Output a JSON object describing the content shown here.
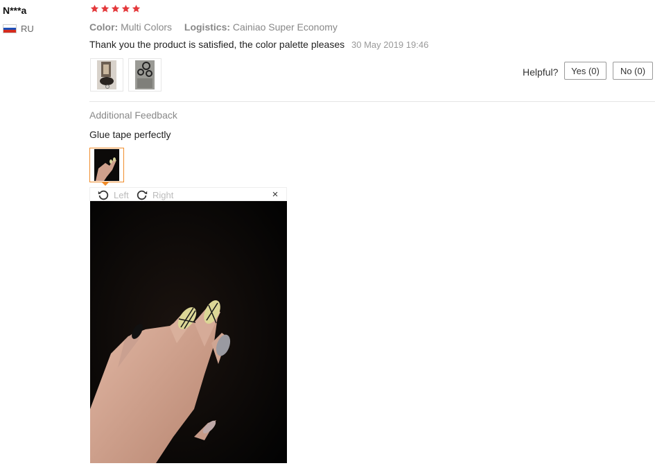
{
  "review": {
    "user_name": "N***a",
    "country_code": "RU",
    "rating": 5,
    "color_label": "Color:",
    "color_value": "Multi Colors",
    "logistics_label": "Logistics:",
    "logistics_value": "Cainiao Super Economy",
    "text": "Thank you the product is satisfied, the color palette pleases",
    "date": "30 May 2019 19:46"
  },
  "helpful": {
    "label": "Helpful?",
    "yes": "Yes (0)",
    "no": "No (0)"
  },
  "additional": {
    "title": "Additional Feedback",
    "text": "Glue tape perfectly"
  },
  "viewer": {
    "rotate_left": "Left",
    "rotate_right": "Right",
    "close_glyph": "×"
  },
  "colors": {
    "star": "#e4393c",
    "active_thumb_border": "#f08c2a"
  }
}
